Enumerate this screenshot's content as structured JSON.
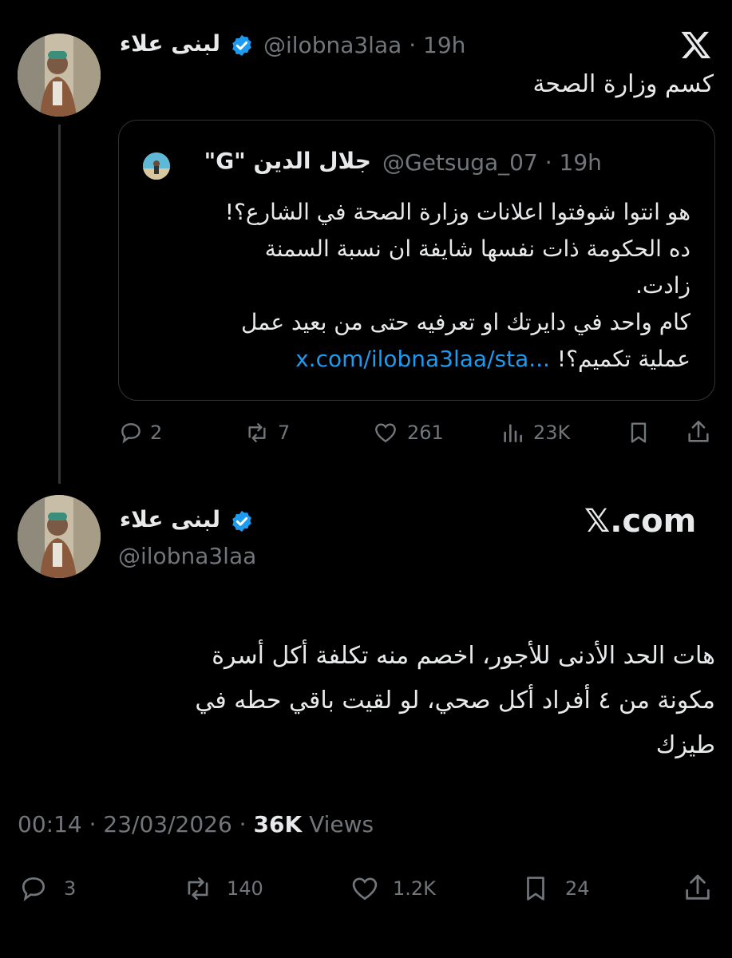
{
  "tweet1": {
    "display_name": "لبنى علاء",
    "handle": "@ilobna3laa",
    "time": "19h",
    "separator": "·",
    "text": "كسم وزارة الصحة",
    "quote": {
      "display_name": "جلال الدين \"G\"",
      "handle": "@Getsuga_07",
      "time": "19h",
      "separator": "·",
      "text_lines": [
        "هو انتوا شوفتوا اعلانات وزارة الصحة في الشارع؟!",
        "ده الحكومة ذات نفسها شايفة ان نسبة السمنة",
        "زادت.",
        "كام واحد في دايرتك او تعرفيه حتى من بعيد عمل",
        "عملية تكميم؟!"
      ],
      "link": "x.com/ilobna3laa/sta..."
    },
    "stats": {
      "replies": "2",
      "reposts": "7",
      "likes": "261",
      "views": "23K"
    }
  },
  "tweet2": {
    "display_name": "لبنى علاء",
    "handle": "@ilobna3laa",
    "brand": "𝕏.com",
    "text_lines": [
      "هات الحد الأدنى للأجور، اخصم منه تكلفة أكل أسرة",
      "مكونة من ٤ أفراد أكل صحي، لو لقيت باقي حطه في",
      "طيزك"
    ],
    "timestamp": "00:14 · 23/03/2026 ·",
    "views_count": "36K",
    "views_label": "Views",
    "stats": {
      "replies": "3",
      "reposts": "140",
      "likes": "1.2K",
      "bookmarks": "24"
    }
  },
  "colors": {
    "background": "#000000",
    "text": "#e7e9ea",
    "muted": "#71767b",
    "accent": "#1d9bf0",
    "border": "#2f3336"
  },
  "icons": [
    "x-logo-icon",
    "verified-badge-icon",
    "reply-icon",
    "repost-icon",
    "like-icon",
    "views-icon",
    "bookmark-icon",
    "share-icon"
  ]
}
